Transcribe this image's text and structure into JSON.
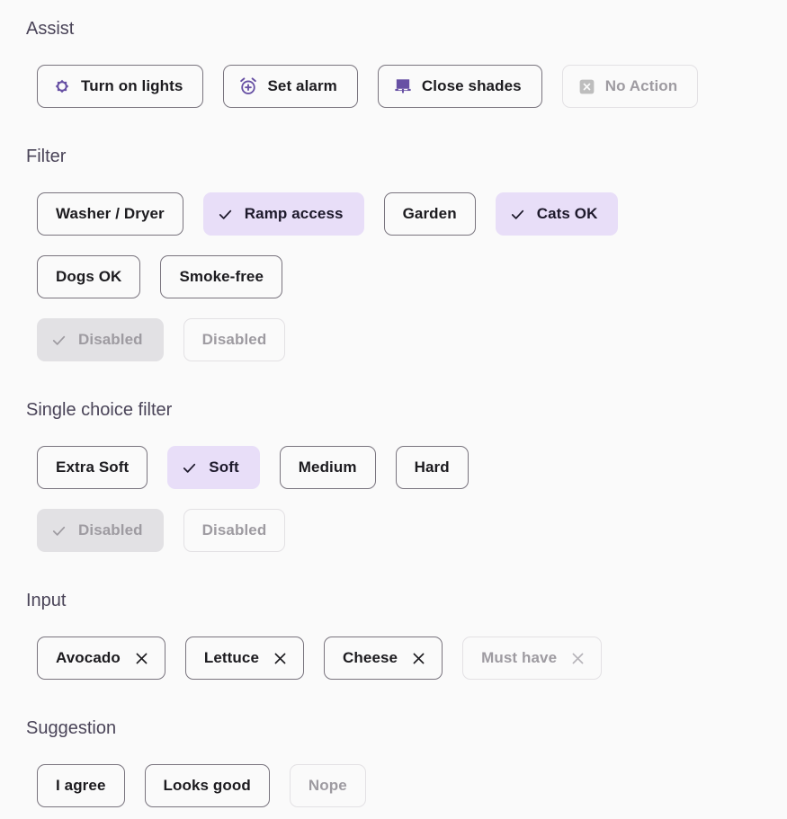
{
  "theme": {
    "background": "#FAFAFA",
    "accent": "#6750A4",
    "selected_bg": "#E8DEF8",
    "outline": "#79747E",
    "label": "#1C1B1F",
    "header": "#4A4458",
    "disabled_text": "#9E9BA1",
    "disabled_selected_bg": "#E2E1E4",
    "disabled_outline": "#E3E1E4"
  },
  "sections": {
    "assist": {
      "title": "Assist",
      "chips": [
        {
          "label": "Turn on lights",
          "icon": "brightness-icon",
          "disabled": false
        },
        {
          "label": "Set alarm",
          "icon": "add-alarm-icon",
          "disabled": false
        },
        {
          "label": "Close shades",
          "icon": "shades-icon",
          "disabled": false
        },
        {
          "label": "No Action",
          "icon": "cancel-box-icon",
          "disabled": true
        }
      ]
    },
    "filter": {
      "title": "Filter",
      "rows": [
        [
          {
            "label": "Washer / Dryer",
            "selected": false,
            "disabled": false
          },
          {
            "label": "Ramp access",
            "selected": true,
            "disabled": false
          },
          {
            "label": "Garden",
            "selected": false,
            "disabled": false
          },
          {
            "label": "Cats OK",
            "selected": true,
            "disabled": false
          }
        ],
        [
          {
            "label": "Dogs OK",
            "selected": false,
            "disabled": false
          },
          {
            "label": "Smoke-free",
            "selected": false,
            "disabled": false
          }
        ],
        [
          {
            "label": "Disabled",
            "selected": true,
            "disabled": true
          },
          {
            "label": "Disabled",
            "selected": false,
            "disabled": true
          }
        ]
      ]
    },
    "single_choice": {
      "title": "Single choice filter",
      "rows": [
        [
          {
            "label": "Extra Soft",
            "selected": false,
            "disabled": false
          },
          {
            "label": "Soft",
            "selected": true,
            "disabled": false
          },
          {
            "label": "Medium",
            "selected": false,
            "disabled": false
          },
          {
            "label": "Hard",
            "selected": false,
            "disabled": false
          }
        ],
        [
          {
            "label": "Disabled",
            "selected": true,
            "disabled": true
          },
          {
            "label": "Disabled",
            "selected": false,
            "disabled": true
          }
        ]
      ]
    },
    "input": {
      "title": "Input",
      "chips": [
        {
          "label": "Avocado",
          "disabled": false,
          "trailing_icon": "close-icon"
        },
        {
          "label": "Lettuce",
          "disabled": false,
          "trailing_icon": "close-icon"
        },
        {
          "label": "Cheese",
          "disabled": false,
          "trailing_icon": "close-icon"
        },
        {
          "label": "Must have",
          "disabled": true,
          "trailing_icon": "close-icon"
        }
      ]
    },
    "suggestion": {
      "title": "Suggestion",
      "chips": [
        {
          "label": "I agree",
          "disabled": false
        },
        {
          "label": "Looks good",
          "disabled": false
        },
        {
          "label": "Nope",
          "disabled": true
        }
      ]
    }
  }
}
